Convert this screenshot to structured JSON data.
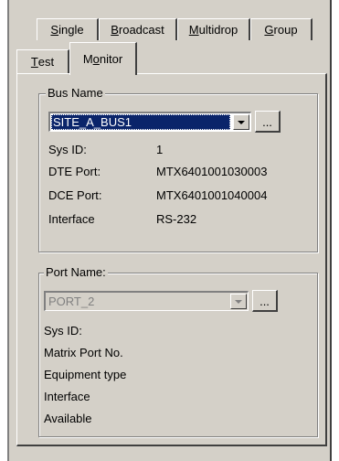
{
  "tabs_row1": [
    {
      "label": "Single",
      "underline": "S",
      "rest": "ingle"
    },
    {
      "label": "Broadcast",
      "underline": "B",
      "rest": "roadcast"
    },
    {
      "label": "Multidrop",
      "underline": "M",
      "rest": "ultidrop"
    },
    {
      "label": "Group",
      "underline": "G",
      "rest": "roup"
    }
  ],
  "tabs_row2": [
    {
      "label": "Test",
      "underline": "T",
      "rest": "est"
    },
    {
      "label": "Monitor",
      "pre": "M",
      "underline": "o",
      "rest": "nitor",
      "active": true
    }
  ],
  "bus_group": {
    "label": "Bus Name",
    "combo_value": "SITE_A_BUS1",
    "browse_label": "...",
    "fields": [
      {
        "label": "Sys ID:",
        "value": "1"
      },
      {
        "label": "DTE Port:",
        "value": "MTX6401001030003"
      },
      {
        "label": "DCE Port:",
        "value": "MTX6401001040004"
      },
      {
        "label": "Interface",
        "value": "RS-232"
      }
    ]
  },
  "port_group": {
    "label": "Port Name:",
    "combo_value": "PORT_2",
    "browse_label": "...",
    "fields": [
      {
        "label": "Sys ID:"
      },
      {
        "label": "Matrix Port No."
      },
      {
        "label": "Equipment type"
      },
      {
        "label": "Interface"
      },
      {
        "label": "Available"
      }
    ]
  }
}
